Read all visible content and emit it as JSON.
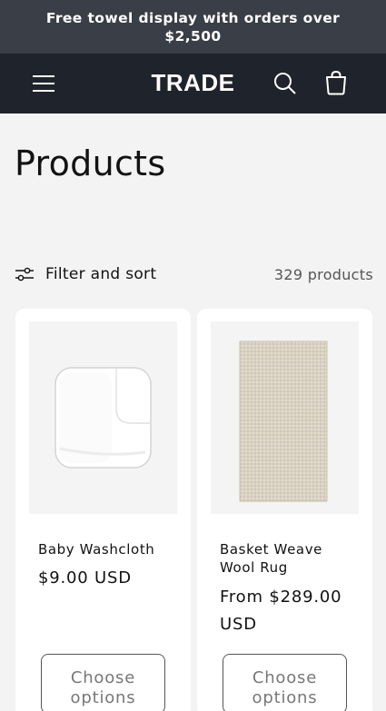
{
  "announcement": {
    "text": "Free towel display with orders over $2,500"
  },
  "header": {
    "logo": "TRADE",
    "icons": {
      "menu": "hamburger-menu-icon",
      "search": "search-icon",
      "cart": "cart-icon"
    }
  },
  "collection": {
    "title": "Products",
    "filter_label": "Filter and sort",
    "product_count": "329 products"
  },
  "products": [
    {
      "title": "Baby Washcloth",
      "price": "$9.00 USD",
      "button": "Choose options",
      "image": "white-washcloth"
    },
    {
      "title": "Basket Weave Wool Rug",
      "price": "From $289.00 USD",
      "button": "Choose options",
      "image": "beige-wool-rug"
    }
  ],
  "colors": {
    "announcement_bg": "#3a3e46",
    "header_bg": "#1f232b",
    "page_bg": "#f3f3f3",
    "card_bg": "#ffffff"
  }
}
